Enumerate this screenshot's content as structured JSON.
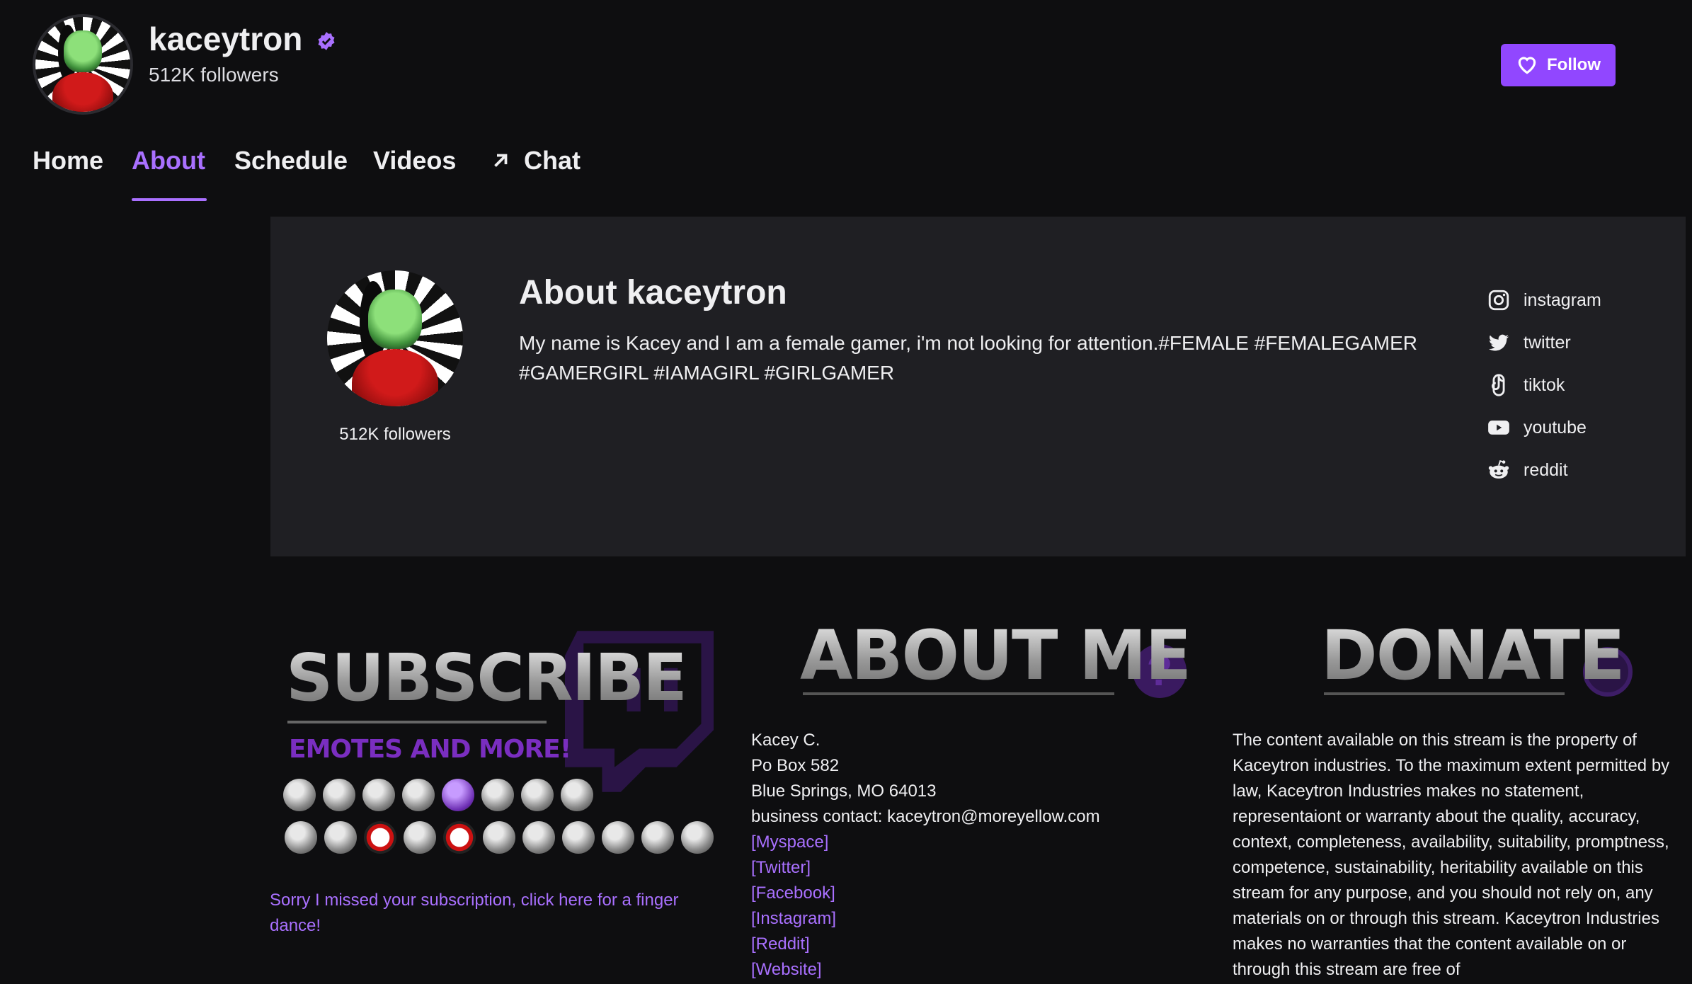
{
  "channel": {
    "name": "kaceytron",
    "followers": "512K followers",
    "verified_icon": "verified-badge-icon"
  },
  "follow_button": {
    "label": "Follow",
    "icon": "heart-icon",
    "color": "#9147ff"
  },
  "nav": {
    "items": [
      {
        "label": "Home",
        "active": false
      },
      {
        "label": "About",
        "active": true
      },
      {
        "label": "Schedule",
        "active": false
      },
      {
        "label": "Videos",
        "active": false
      },
      {
        "label": "Chat",
        "active": false,
        "icon": "external-arrow-icon"
      }
    ],
    "accent": "#a970ff"
  },
  "about": {
    "title": "About kaceytron",
    "followers": "512K followers",
    "description": "My name is Kacey and I am a female gamer, i'm not looking for attention.#FEMALE #FEMALEGAMER #GAMERGIRL #IAMAGIRL #GIRLGAMER",
    "socials": [
      {
        "label": "instagram",
        "icon": "instagram-icon"
      },
      {
        "label": "twitter",
        "icon": "twitter-icon"
      },
      {
        "label": "tiktok",
        "icon": "tiktok-icon"
      },
      {
        "label": "youtube",
        "icon": "youtube-icon"
      },
      {
        "label": "reddit",
        "icon": "reddit-icon"
      }
    ]
  },
  "panels": {
    "subscribe": {
      "title": "SUBSCRIBE",
      "subtitle": "EMOTES AND MORE!",
      "link_text": "Sorry I missed your subscription, click here for a finger dance!"
    },
    "about_me": {
      "title": "ABOUT ME",
      "lines": [
        "Kacey C.",
        "Po Box 582",
        "Blue Springs, MO 64013",
        "business contact: kaceytron@moreyellow.com"
      ],
      "links": [
        "[Myspace]",
        "[Twitter]",
        "[Facebook]",
        "[Instagram]",
        "[Reddit]",
        "[Website]"
      ]
    },
    "donate": {
      "title": "DONATE",
      "text": "The content available on this stream is the property of Kaceytron industries. To the maximum extent permitted by law, Kaceytron Industries makes no statement, representaiont or warranty about the quality, accuracy, context, completeness, availability, suitability, promptness, competence, sustainability, heritability available on this stream for any purpose, and you should not rely on, any materials on or through this stream. Kaceytron Industries makes no warranties that the content available on or through this stream are free of"
    }
  }
}
